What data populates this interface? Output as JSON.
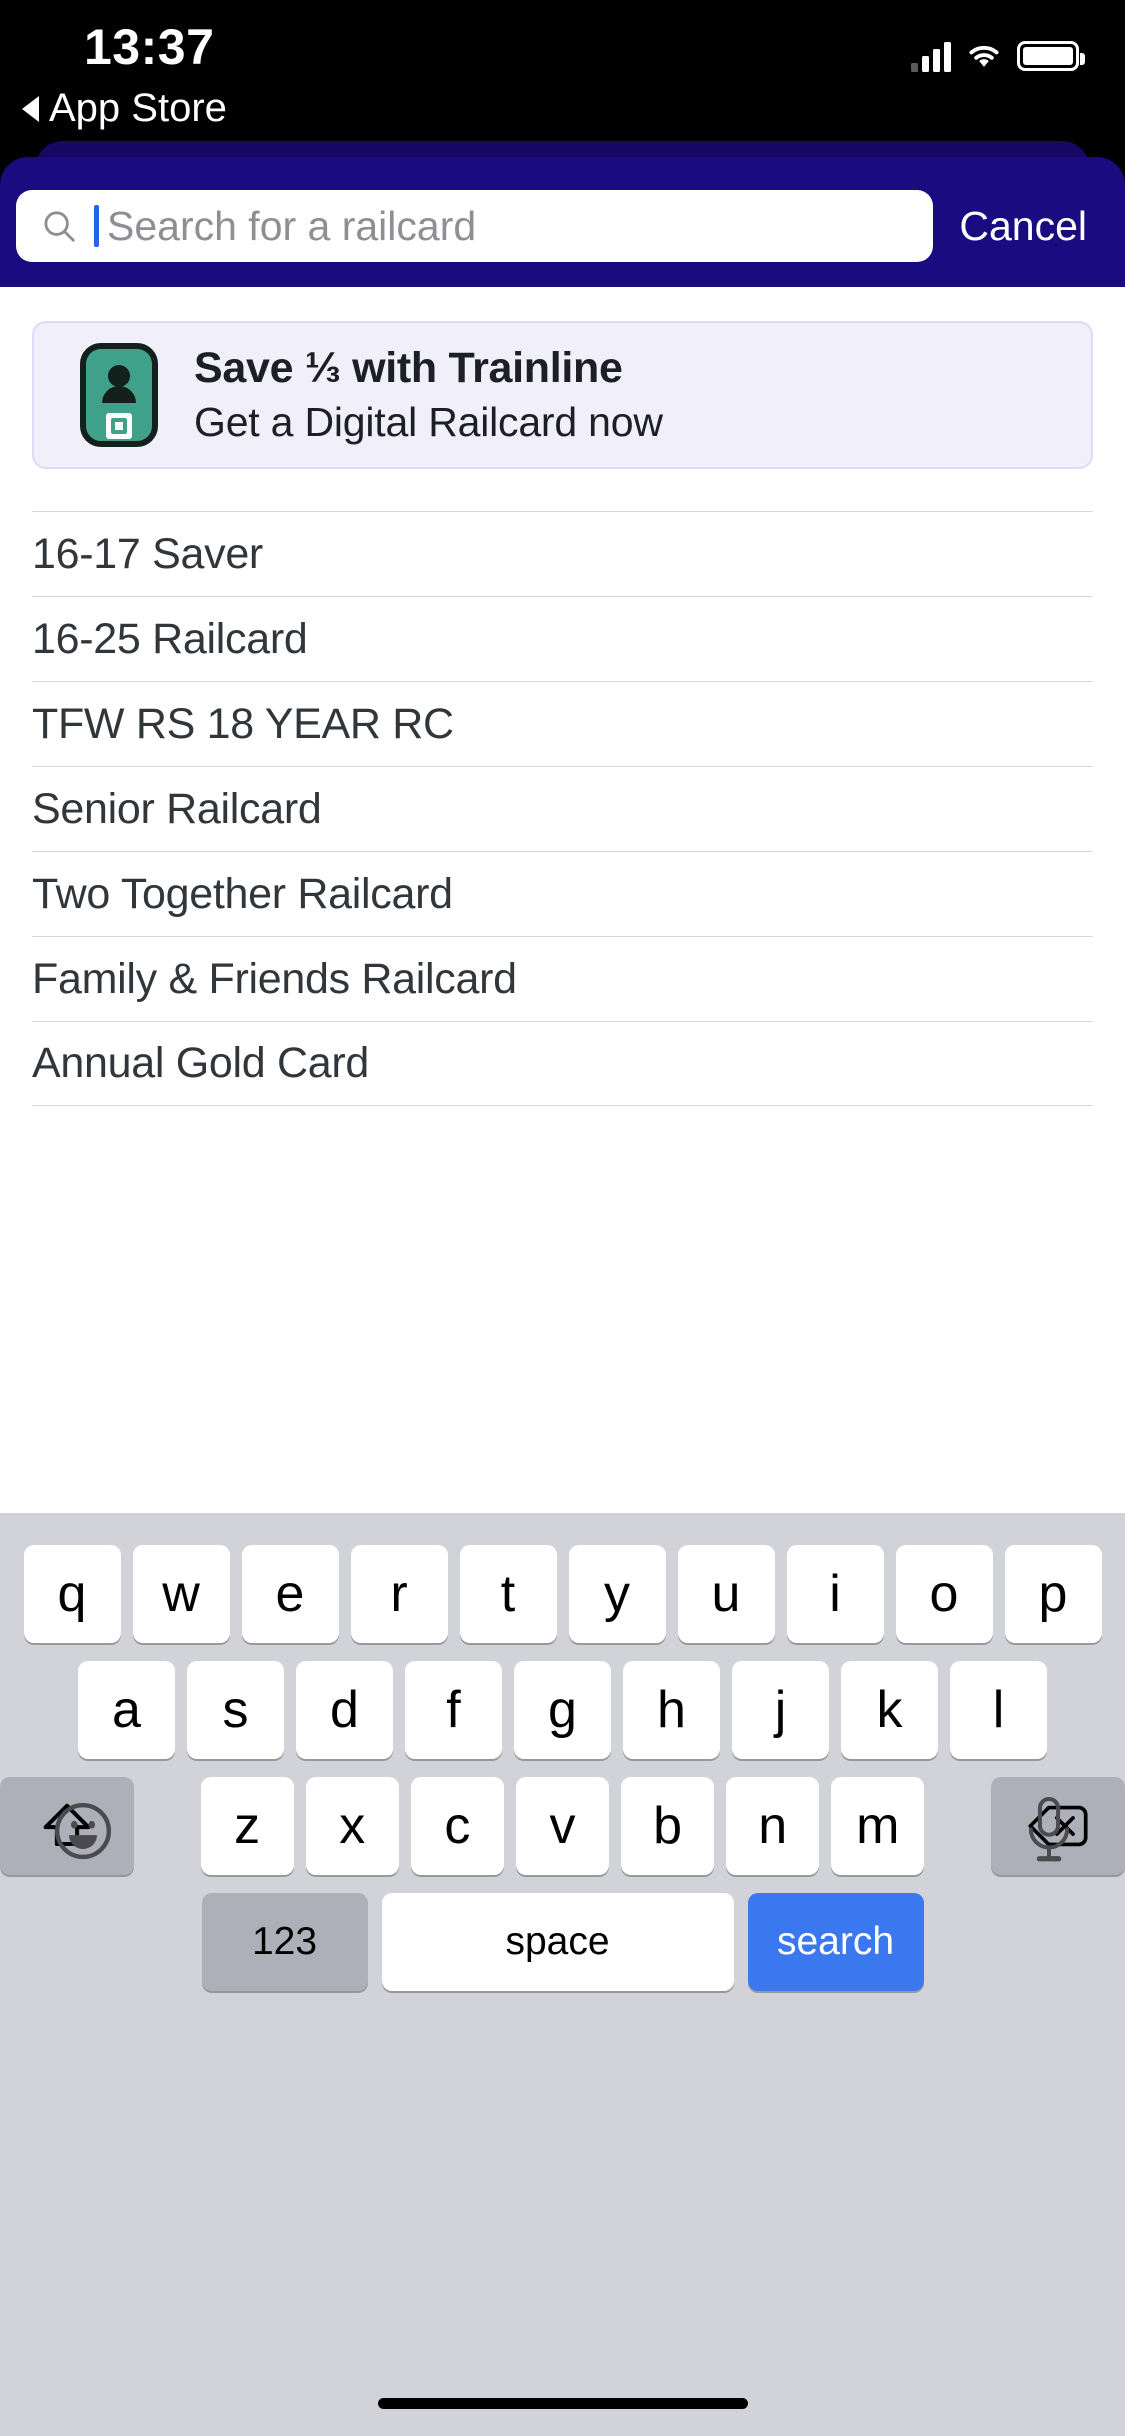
{
  "status_bar": {
    "time": "13:37",
    "back_label": "App Store",
    "icons": {
      "signal": "cellular-signal-icon",
      "wifi": "wifi-icon",
      "battery": "battery-icon",
      "back": "back-triangle-icon"
    }
  },
  "search": {
    "placeholder": "Search for a railcard",
    "value": "",
    "cancel_label": "Cancel",
    "icon": "search-icon",
    "header_color": "#1b0b80",
    "header_back_color": "#170863",
    "caret_color": "#2563eb"
  },
  "promo": {
    "title": "Save ⅓ with Trainline",
    "subtitle": "Get a Digital Railcard now",
    "icon": "digital-railcard-icon",
    "background": "#f0effa",
    "border": "#ded9f5",
    "icon_color": "#3fa189"
  },
  "list": {
    "items": [
      {
        "label": "16-17 Saver"
      },
      {
        "label": "16-25 Railcard"
      },
      {
        "label": "TFW RS 18 YEAR RC"
      },
      {
        "label": "Senior Railcard"
      },
      {
        "label": "Two Together Railcard"
      },
      {
        "label": "Family & Friends Railcard"
      },
      {
        "label": "Annual Gold Card"
      }
    ]
  },
  "keyboard": {
    "row1": [
      "q",
      "w",
      "e",
      "r",
      "t",
      "y",
      "u",
      "i",
      "o",
      "p"
    ],
    "row2": [
      "a",
      "s",
      "d",
      "f",
      "g",
      "h",
      "j",
      "k",
      "l"
    ],
    "row3": [
      "z",
      "x",
      "c",
      "v",
      "b",
      "n",
      "m"
    ],
    "shift_icon": "shift-arrow-icon",
    "backspace_icon": "backspace-icon",
    "numeric_label": "123",
    "space_label": "space",
    "search_label": "search",
    "search_key_color": "#3b77ef",
    "emoji_icon": "emoji-smiley-icon",
    "mic_icon": "microphone-icon",
    "background": "#d1d3d9"
  }
}
